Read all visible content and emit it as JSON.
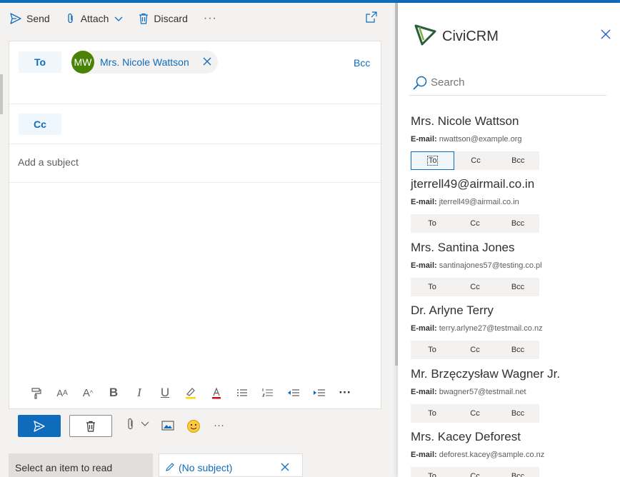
{
  "toolbar": {
    "send_label": "Send",
    "attach_label": "Attach",
    "discard_label": "Discard",
    "more_label": "···"
  },
  "compose": {
    "to_label": "To",
    "cc_label": "Cc",
    "bcc_label": "Bcc",
    "recipient": {
      "initials": "MW",
      "name": "Mrs. Nicole Wattson"
    },
    "subject_placeholder": "Add a subject"
  },
  "format_toolbar": {
    "bold": "B",
    "italic": "I",
    "underline": "U",
    "more": "···"
  },
  "action_bar": {
    "more": "···"
  },
  "tabs": {
    "reading_pane": "Select an item to read",
    "draft": "(No subject)"
  },
  "civicrm": {
    "title": "CiviCRM",
    "search_placeholder": "Search",
    "email_label": "E-mail:",
    "btn_to": "To",
    "btn_cc": "Cc",
    "btn_bcc": "Bcc",
    "contacts": [
      {
        "name": "Mrs. Nicole Wattson",
        "email": "nwattson@example.org"
      },
      {
        "name": "jterrell49@airmail.co.in",
        "email": "jterrell49@airmail.co.in"
      },
      {
        "name": "Mrs. Santina Jones",
        "email": "santinajones57@testing.co.pl"
      },
      {
        "name": "Dr. Arlyne Terry",
        "email": "terry.arlyne27@testmail.co.nz"
      },
      {
        "name": "Mr. Brzęczysław Wagner Jr.",
        "email": "bwagner57@testmail.net"
      },
      {
        "name": "Mrs. Kacey Deforest",
        "email": "deforest.kacey@sample.co.nz"
      }
    ]
  },
  "colors": {
    "accent": "#0f6cbd",
    "avatar": "#498205"
  }
}
